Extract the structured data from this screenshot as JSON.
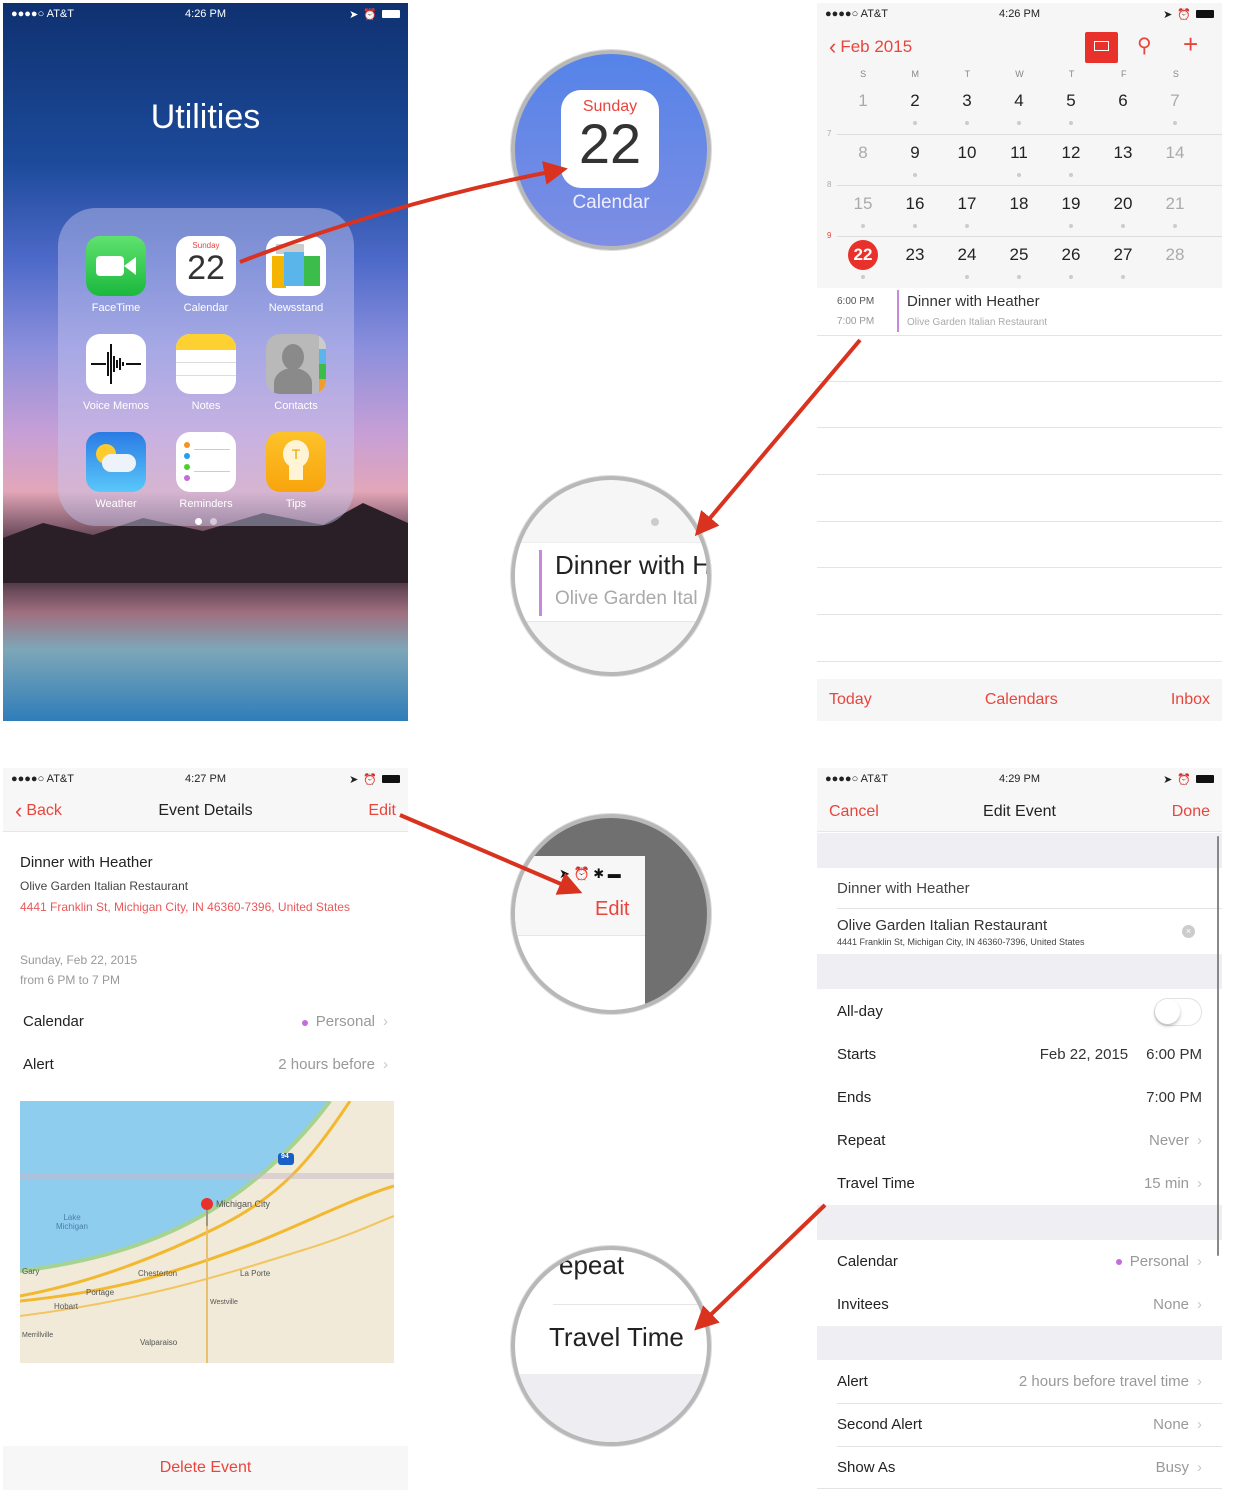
{
  "colors": {
    "accent": "#e8453c",
    "arrow": "#d9321f",
    "calendar_dot": "#c36ddb",
    "today_circle": "#e8312a"
  },
  "home_screen": {
    "status": {
      "carrier": "●●●●○ AT&T",
      "time": "4:26 PM"
    },
    "folder_title": "Utilities",
    "apps": [
      {
        "label": "FaceTime",
        "icon": "facetime-icon"
      },
      {
        "label": "Calendar",
        "icon": "calendar-icon",
        "weekday": "Sunday",
        "date": "22"
      },
      {
        "label": "Newsstand",
        "icon": "newsstand-icon"
      },
      {
        "label": "Voice Memos",
        "icon": "voice-memos-icon"
      },
      {
        "label": "Notes",
        "icon": "notes-icon"
      },
      {
        "label": "Contacts",
        "icon": "contacts-icon"
      },
      {
        "label": "Weather",
        "icon": "weather-icon"
      },
      {
        "label": "Reminders",
        "icon": "reminders-icon"
      },
      {
        "label": "Tips",
        "icon": "tips-icon"
      }
    ],
    "page_count": 2,
    "current_page": 1
  },
  "magnifiers": {
    "calendar_app": {
      "weekday": "Sunday",
      "date": "22",
      "label": "Calendar"
    },
    "event": {
      "title": "Dinner with H",
      "subtitle": "Olive Garden Ital"
    },
    "edit": {
      "label": "Edit"
    },
    "travel_time": {
      "above": "epeat",
      "label": "Travel Time"
    }
  },
  "calendar_month": {
    "status": {
      "carrier": "●●●●○ AT&T",
      "time": "4:26 PM"
    },
    "back_label": "Feb 2015",
    "weekday_headers": [
      "S",
      "M",
      "T",
      "W",
      "T",
      "F",
      "S"
    ],
    "weeks": [
      {
        "week_number": "",
        "days": [
          "1",
          "2",
          "3",
          "4",
          "5",
          "6",
          "7"
        ],
        "dots": [
          false,
          true,
          true,
          true,
          true,
          false,
          true
        ]
      },
      {
        "week_number": "7",
        "days": [
          "8",
          "9",
          "10",
          "11",
          "12",
          "13",
          "14"
        ],
        "dots": [
          false,
          true,
          false,
          true,
          true,
          false,
          false
        ]
      },
      {
        "week_number": "8",
        "days": [
          "15",
          "16",
          "17",
          "18",
          "19",
          "20",
          "21"
        ],
        "dots": [
          true,
          true,
          true,
          false,
          true,
          true,
          true
        ]
      },
      {
        "week_number": "9",
        "days": [
          "22",
          "23",
          "24",
          "25",
          "26",
          "27",
          "28"
        ],
        "dots": [
          true,
          false,
          true,
          true,
          true,
          true,
          false
        ]
      }
    ],
    "selected_day": "22",
    "event": {
      "start": "6:00 PM",
      "end": "7:00 PM",
      "title": "Dinner with Heather",
      "location": "Olive Garden Italian Restaurant"
    },
    "tabs": [
      "Today",
      "Calendars",
      "Inbox"
    ]
  },
  "event_details": {
    "status": {
      "carrier": "●●●●○ AT&T",
      "time": "4:27 PM"
    },
    "back_label": "Back",
    "title": "Event Details",
    "edit_label": "Edit",
    "event_title": "Dinner with Heather",
    "location_name": "Olive Garden Italian Restaurant",
    "address": "4441 Franklin St, Michigan City, IN  46360-7396, United States",
    "date": "Sunday, Feb 22, 2015",
    "time_range": "from 6 PM to 7 PM",
    "rows": [
      {
        "label": "Calendar",
        "value": "Personal",
        "dot": true
      },
      {
        "label": "Alert",
        "value": "2 hours before",
        "dot": false
      }
    ],
    "map_labels": [
      "Lake Michigan",
      "Michigan City",
      "Chesterton",
      "La Porte",
      "Portage",
      "Hobart",
      "Westville",
      "Valparaiso",
      "Merrillville",
      "Gary",
      "94"
    ],
    "delete_label": "Delete Event"
  },
  "edit_event": {
    "status": {
      "carrier": "●●●●○ AT&T",
      "time": "4:29 PM"
    },
    "cancel_label": "Cancel",
    "title": "Edit Event",
    "done_label": "Done",
    "event_title": "Dinner with Heather",
    "location_name": "Olive Garden Italian Restaurant",
    "address": "4441 Franklin St, Michigan City, IN  46360-7396, United States",
    "all_day": {
      "label": "All-day",
      "on": false
    },
    "starts": {
      "label": "Starts",
      "date": "Feb 22, 2015",
      "time": "6:00 PM"
    },
    "ends": {
      "label": "Ends",
      "time": "7:00 PM"
    },
    "repeat": {
      "label": "Repeat",
      "value": "Never"
    },
    "travel_time": {
      "label": "Travel Time",
      "value": "15 min"
    },
    "calendar": {
      "label": "Calendar",
      "value": "Personal"
    },
    "invitees": {
      "label": "Invitees",
      "value": "None"
    },
    "alert": {
      "label": "Alert",
      "value": "2 hours before travel time"
    },
    "second_alert": {
      "label": "Second Alert",
      "value": "None"
    },
    "show_as": {
      "label": "Show As",
      "value": "Busy"
    }
  }
}
